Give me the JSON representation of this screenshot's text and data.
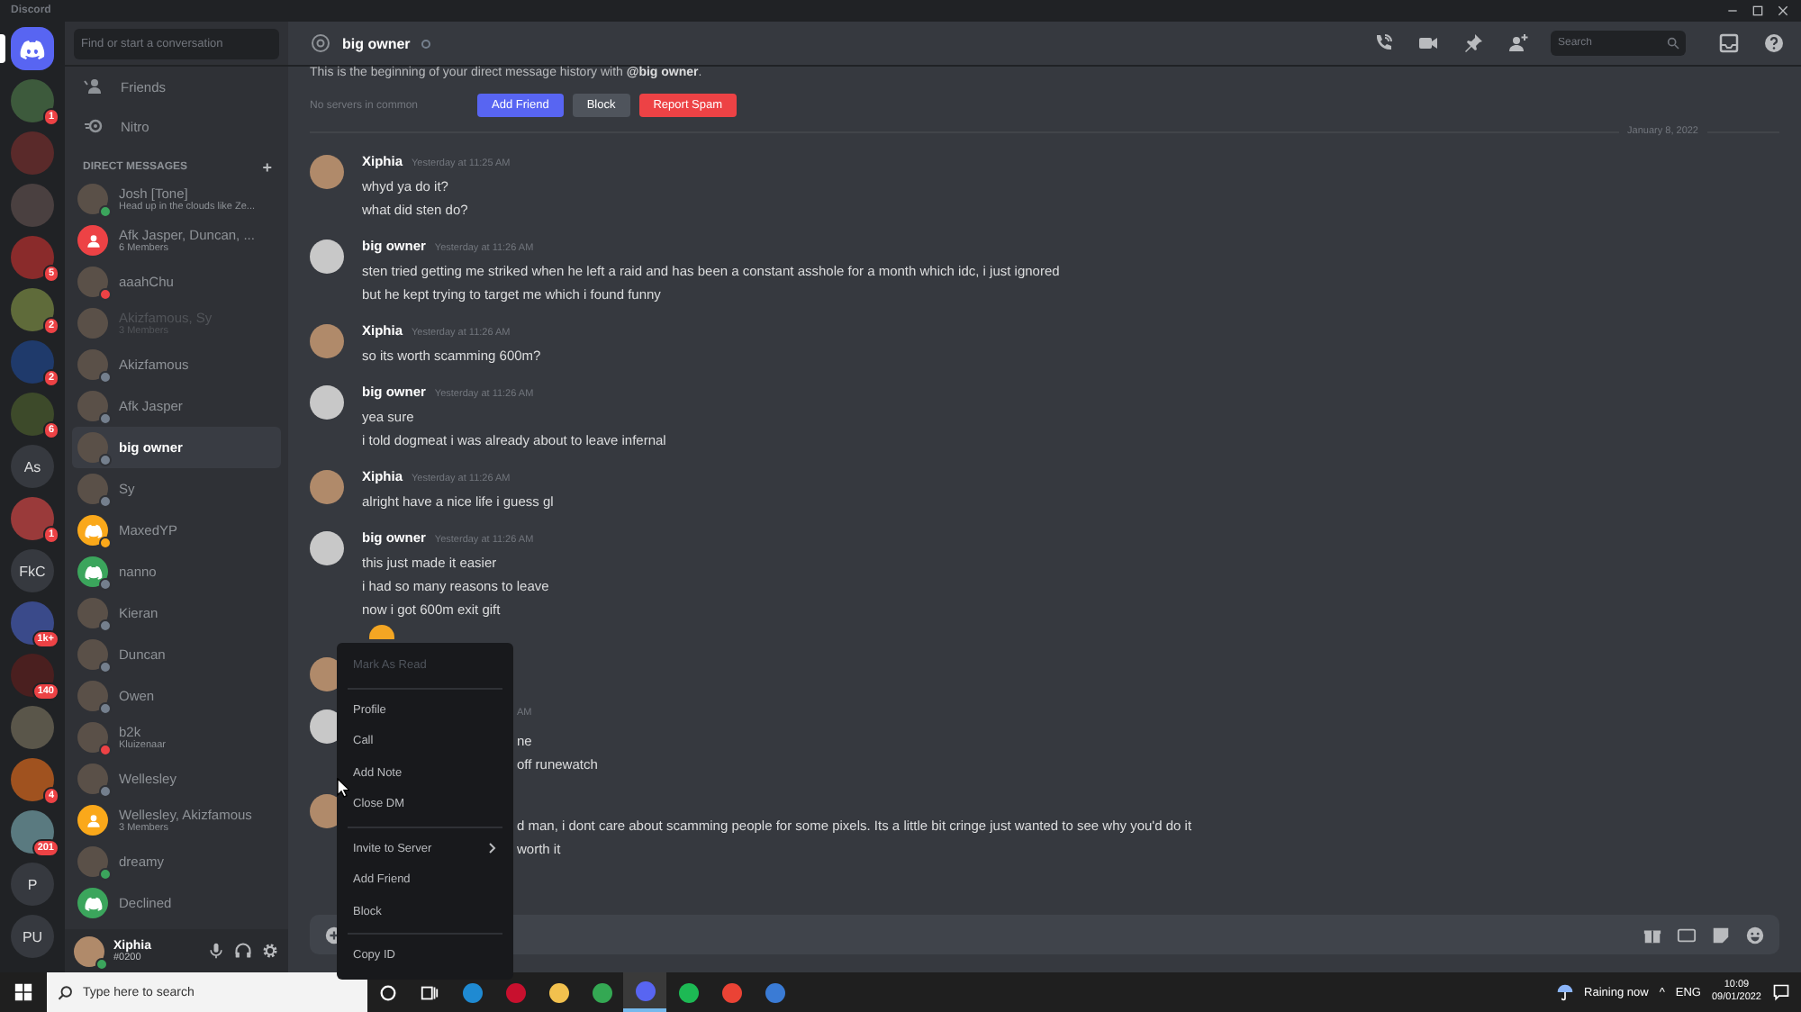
{
  "window": {
    "title": "Discord"
  },
  "servers": [
    {
      "kind": "home",
      "selected": true
    },
    {
      "kind": "image",
      "color": "#3d5a3c",
      "badge": "1",
      "selected": false
    },
    {
      "kind": "image",
      "color": "#5a2a2a",
      "selected": false
    },
    {
      "kind": "image",
      "color": "#4a4040",
      "selected": false
    },
    {
      "kind": "image",
      "color": "#8a2b2b",
      "badge": "5",
      "selected": false
    },
    {
      "kind": "image",
      "color": "#5f6b3a",
      "badge": "2",
      "selected": false
    },
    {
      "kind": "image",
      "color": "#1f3a6b",
      "badge": "2",
      "selected": false
    },
    {
      "kind": "image",
      "color": "#3d4a2a",
      "badge": "6",
      "selected": false
    },
    {
      "kind": "text",
      "label": "As",
      "selected": false
    },
    {
      "kind": "image",
      "color": "#9a3a3a",
      "badge": "1",
      "selected": false
    },
    {
      "kind": "text",
      "label": "FkC",
      "selected": false
    },
    {
      "kind": "image",
      "color": "#3a4a8a",
      "badge": "1k+",
      "selected": false
    },
    {
      "kind": "image",
      "color": "#4a1f1f",
      "badge": "140",
      "selected": false
    },
    {
      "kind": "image",
      "color": "#5a564a",
      "selected": false
    },
    {
      "kind": "image",
      "color": "#a0521f",
      "badge": "4",
      "selected": false
    },
    {
      "kind": "image",
      "color": "#5a7a80",
      "badge": "201",
      "selected": false
    },
    {
      "kind": "text",
      "label": "P",
      "selected": false
    },
    {
      "kind": "text",
      "label": "PU",
      "selected": false
    }
  ],
  "dms": {
    "search": {
      "placeholder": "Find or start a conversation"
    },
    "nav": [
      {
        "kind": "friends",
        "label": "Friends"
      },
      {
        "kind": "nitro",
        "label": "Nitro"
      }
    ],
    "heading": "DIRECT MESSAGES",
    "add": "+",
    "items": [
      {
        "kind": "photo",
        "name": "Josh [Tone]",
        "subtitle": "Head up in the clouds like Ze...",
        "color": "#3ba55c",
        "selected": false,
        "dimmed": false
      },
      {
        "kind": "group",
        "name": "Afk Jasper, Duncan, ...",
        "subtitle": "6 Members",
        "avatar": {
          "color": "#ed4245"
        },
        "selected": false,
        "dimmed": false
      },
      {
        "kind": "photo",
        "name": "aaahChu",
        "color": "#ed4245",
        "selected": false,
        "dimmed": false
      },
      {
        "kind": "photo",
        "name": "Akizfamous, Sy",
        "subtitle": "3 Members",
        "selected": false,
        "dimmed": true
      },
      {
        "kind": "photo",
        "name": "Akizfamous",
        "color": "#747f8d",
        "selected": false,
        "dimmed": false
      },
      {
        "kind": "photo",
        "name": "Afk Jasper",
        "color": "#747f8d",
        "selected": false,
        "dimmed": false
      },
      {
        "kind": "photo",
        "name": "big owner",
        "color": "#747f8d",
        "selected": true,
        "dimmed": false
      },
      {
        "kind": "photo",
        "name": "Sy",
        "color": "#747f8d",
        "selected": false,
        "dimmed": false
      },
      {
        "kind": "default",
        "name": "MaxedYP",
        "avatar": {
          "color": "#faa81a"
        },
        "color": "#faa81a",
        "selected": false,
        "dimmed": false
      },
      {
        "kind": "default",
        "name": "nanno",
        "avatar": {
          "color": "#3ba55c"
        },
        "color": "#747f8d",
        "selected": false,
        "dimmed": false
      },
      {
        "kind": "photo",
        "name": "Kieran",
        "color": "#747f8d",
        "selected": false,
        "dimmed": false
      },
      {
        "kind": "photo",
        "name": "Duncan",
        "color": "#747f8d",
        "selected": false,
        "dimmed": false
      },
      {
        "kind": "photo",
        "name": "Owen",
        "color": "#747f8d",
        "selected": false,
        "dimmed": false
      },
      {
        "kind": "photo",
        "name": "b2k",
        "subtitle": "Kluizenaar",
        "color": "#ed4245",
        "selected": false,
        "dimmed": false
      },
      {
        "kind": "photo",
        "name": "Wellesley",
        "color": "#747f8d",
        "selected": false,
        "dimmed": false
      },
      {
        "kind": "group",
        "name": "Wellesley, Akizfamous",
        "subtitle": "3 Members",
        "avatar": {
          "color": "#faa81a"
        },
        "selected": false,
        "dimmed": false
      },
      {
        "kind": "photo",
        "name": "dreamy",
        "color": "#3ba55c",
        "selected": false,
        "dimmed": false
      },
      {
        "kind": "default",
        "name": "Declined",
        "avatar": {
          "color": "#3ba55c"
        },
        "selected": false,
        "dimmed": false
      }
    ],
    "user": {
      "name": "Xiphia",
      "tag": "#0200",
      "online": true
    }
  },
  "chat": {
    "title": "big owner",
    "online": false,
    "search": {
      "placeholder": "Search"
    },
    "intro": "This is the beginning of your direct message history with **@big owner**.",
    "mutual": "No servers in common",
    "buttons": [
      {
        "kind": "primary",
        "label": "Add Friend"
      },
      {
        "kind": "secondary",
        "label": "Block"
      },
      {
        "kind": "danger",
        "label": "Report Spam"
      }
    ],
    "date": "January 8, 2022",
    "messages": [
      {
        "kind": "self",
        "author": "Xiphia",
        "time": "Yesterday at 11:25 AM",
        "lines": [
          "whyd ya do it?",
          "what did sten do?"
        ]
      },
      {
        "kind": "other",
        "author": "big owner",
        "time": "Yesterday at 11:26 AM",
        "lines": [
          "sten tried getting me striked when he left a raid and has been a constant asshole for a month which idc, i just ignored",
          "but he kept trying to target me which i found funny"
        ]
      },
      {
        "kind": "self",
        "author": "Xiphia",
        "time": "Yesterday at 11:26 AM",
        "lines": [
          "so its worth scamming 600m?"
        ]
      },
      {
        "kind": "other",
        "author": "big owner",
        "time": "Yesterday at 11:26 AM",
        "lines": [
          "yea sure",
          "i told dogmeat i was already about to leave infernal"
        ]
      },
      {
        "kind": "self",
        "author": "Xiphia",
        "time": "Yesterday at 11:26 AM",
        "lines": [
          "alright have  a nice life i guess gl"
        ]
      },
      {
        "kind": "other",
        "author": "big owner",
        "time": "Yesterday at 11:26 AM",
        "lines": [
          "this just made it easier",
          "i had so many reasons to leave",
          "now i got 600m exit gift"
        ],
        "emoji": true
      },
      {
        "kind": "self",
        "covered": true
      },
      {
        "kind": "other",
        "covered": true,
        "time": "AM",
        "lines": [
          "ne",
          "off runewatch"
        ]
      },
      {
        "kind": "self",
        "covered": true,
        "lines": [
          "d man, i dont care about scamming people for some pixels. Its a little bit cringe just wanted to see why you'd do it",
          "worth it"
        ]
      }
    ]
  },
  "context_menu": {
    "groups": [
      [
        {
          "label": "Mark As Read",
          "disabled": true,
          "submenu": false
        }
      ],
      [
        {
          "label": "Profile",
          "disabled": false,
          "submenu": false
        },
        {
          "label": "Call",
          "disabled": false,
          "submenu": false
        },
        {
          "label": "Add Note",
          "disabled": false,
          "submenu": false
        },
        {
          "label": "Close DM",
          "disabled": false,
          "submenu": false
        }
      ],
      [
        {
          "label": "Invite to Server",
          "disabled": false,
          "submenu": true
        },
        {
          "label": "Add Friend",
          "disabled": false,
          "submenu": false
        },
        {
          "label": "Block",
          "disabled": false,
          "submenu": false
        }
      ],
      [
        {
          "label": "Copy ID",
          "disabled": false,
          "submenu": false
        }
      ]
    ]
  },
  "taskbar": {
    "search": {
      "placeholder": "Type here to search"
    },
    "apps": [
      {
        "color": "#1f8ad2",
        "selected": false
      },
      {
        "color": "#c8102e",
        "selected": false
      },
      {
        "color": "#f2c14e",
        "selected": false
      },
      {
        "color": "#34a853",
        "selected": false
      },
      {
        "color": "#5865f2",
        "selected": true
      },
      {
        "color": "#1db954",
        "selected": false
      },
      {
        "color": "#ea4335",
        "selected": false
      },
      {
        "color": "#3a7bd5",
        "selected": false
      }
    ],
    "weather": "Raining now",
    "chevron": "^",
    "language": "ENG",
    "time": "10:09",
    "date": "09/01/2022"
  }
}
